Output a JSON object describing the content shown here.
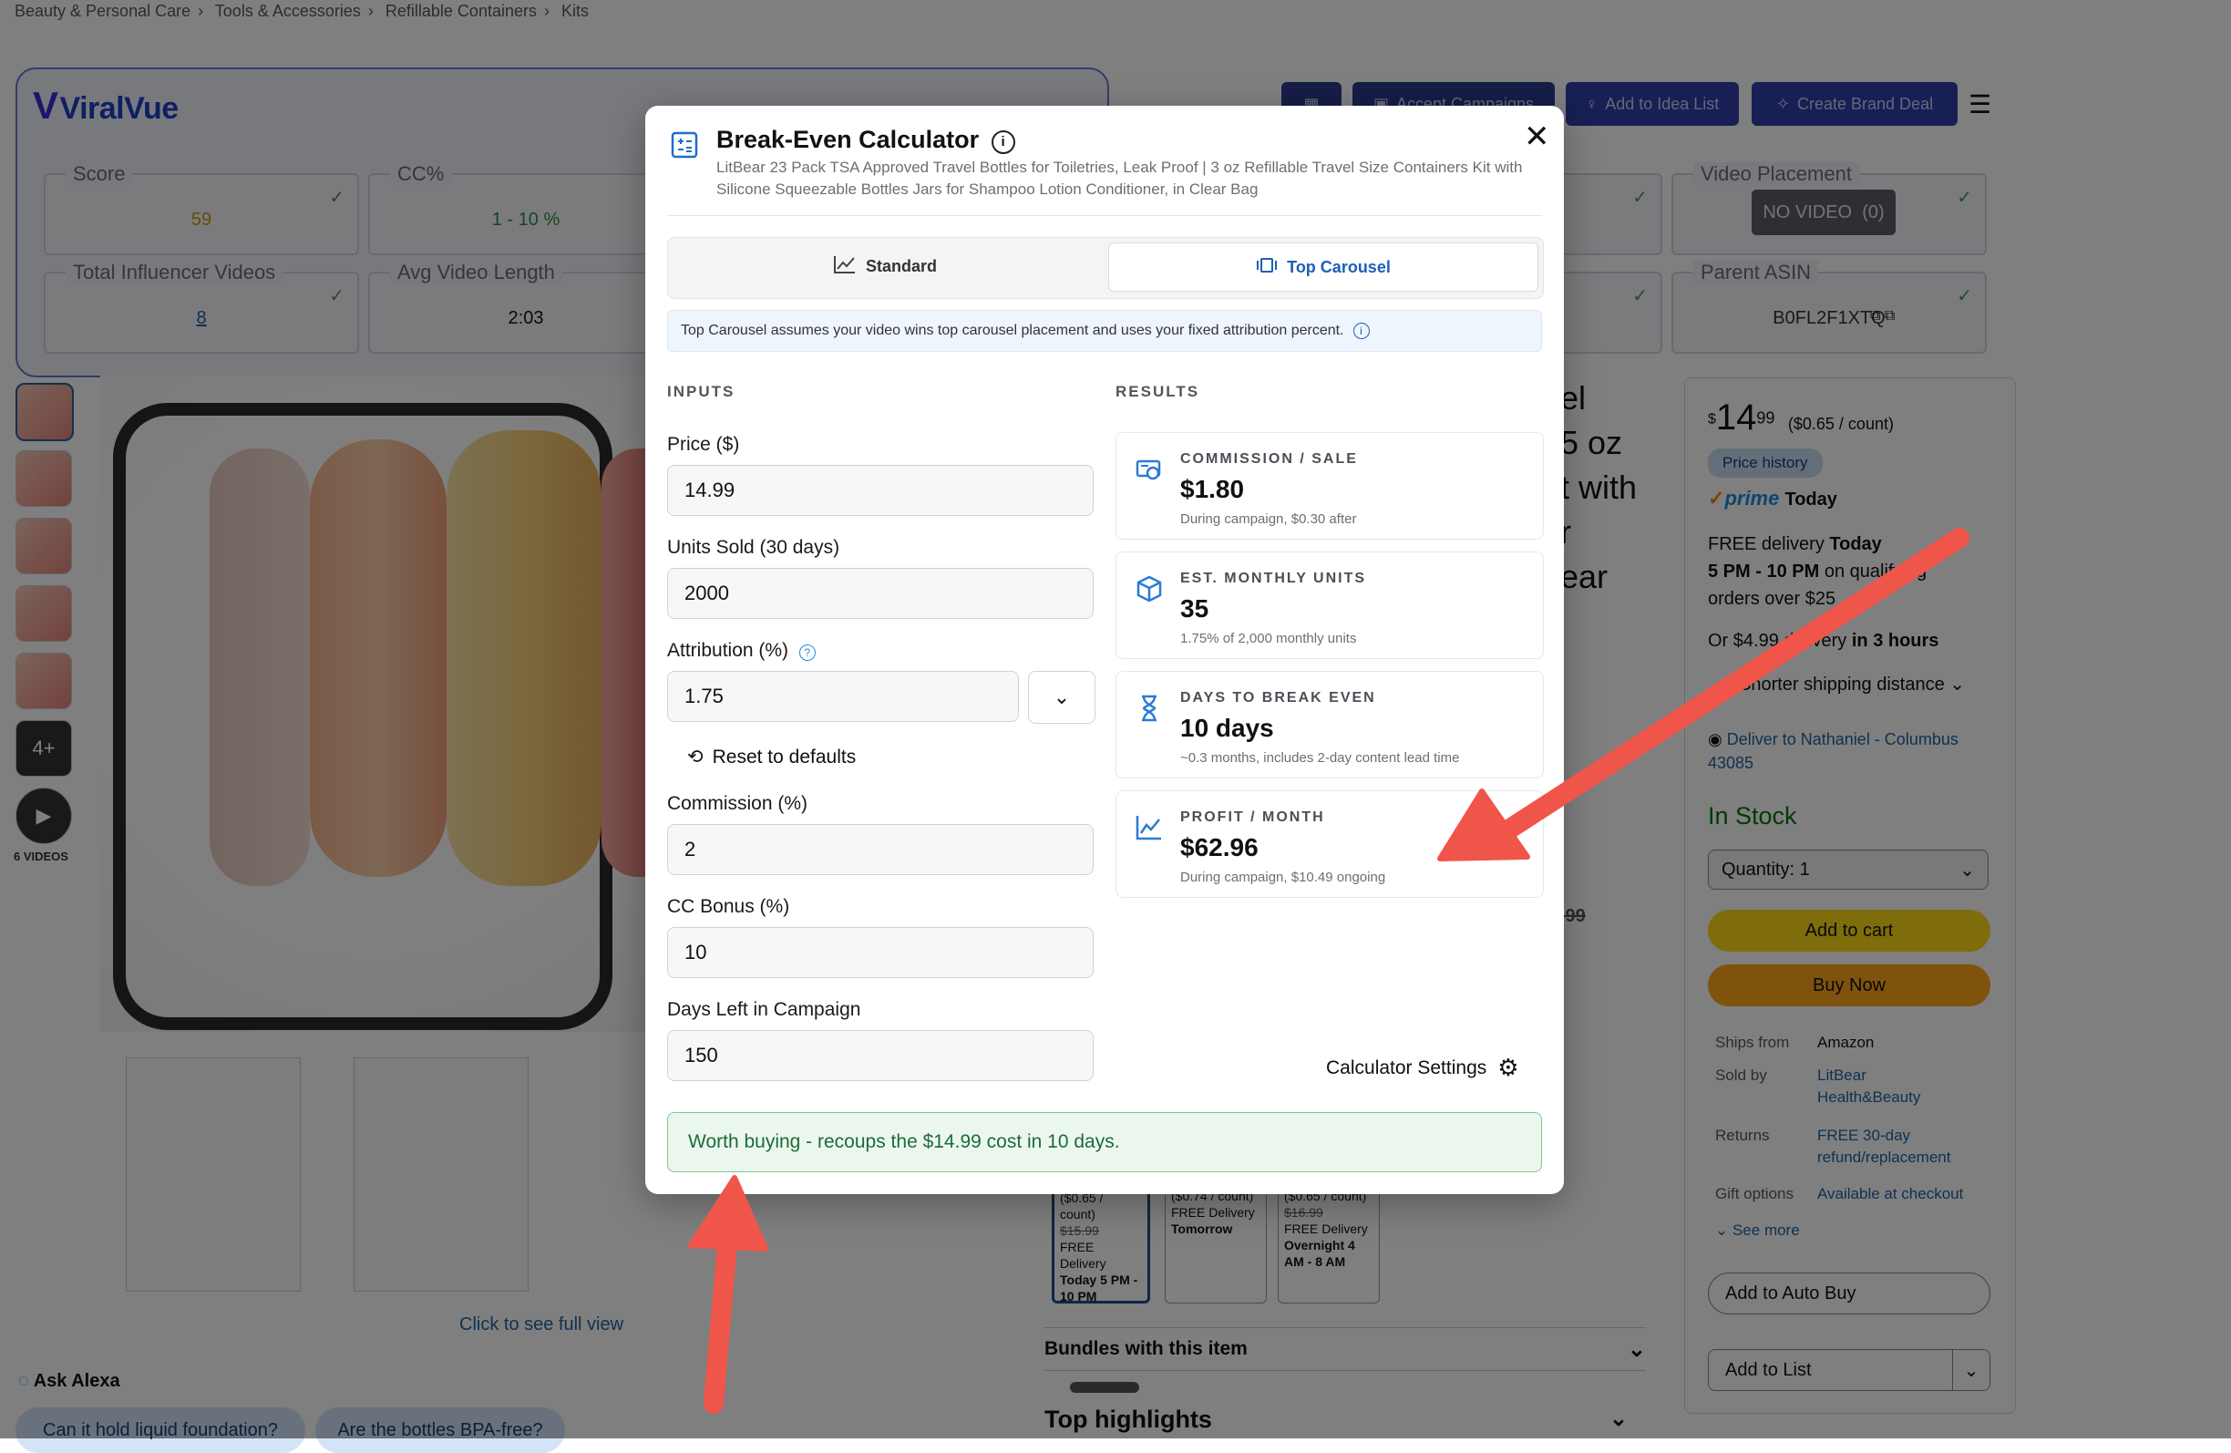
{
  "breadcrumb": [
    "Beauty & Personal Care",
    "Tools & Accessories",
    "Refillable Containers",
    "Kits"
  ],
  "viralvue": {
    "logo": "ViralVue",
    "toolbar": {
      "campaigns_label": "Accept Campaigns",
      "idea_label": "Add to Idea List",
      "brand_deal_label": "Create Brand Deal"
    },
    "metrics": {
      "score_label": "Score",
      "score_value": "59",
      "cc_label": "CC%",
      "cc_value": "1 - 10 %",
      "videos_label": "Total Influencer Videos",
      "videos_value": "8",
      "avglen_label": "Avg Video Length",
      "avglen_value": "2:03",
      "placement_label": "Video Placement",
      "placement_value": "NO VIDEO  (0)",
      "parent_label": "Parent ASIN",
      "parent_value": "B0FL2F1XTQ"
    }
  },
  "gallery": {
    "more_label": "4+",
    "videos_label": "6 VIDEOS",
    "full_view": "Click to see full view"
  },
  "alexa": {
    "title": "Ask Alexa",
    "q1": "Can it hold liquid foundation?",
    "q2": "Are the bottles BPA-free?"
  },
  "product_partial": {
    "title_lines": [
      "el",
      "5 oz",
      "t with",
      "r",
      "ear"
    ],
    "price_fragment": ".99",
    "bundles": "Bundles with this item",
    "highlights": "Top highlights",
    "options": [
      {
        "unit": "($0.65 / count)",
        "was": "$15.99",
        "delivery": "FREE Delivery",
        "when": "Today 5 PM - 10 PM"
      },
      {
        "unit": "($0.74 / count)",
        "was": "",
        "delivery": "FREE Delivery",
        "when": "Tomorrow"
      },
      {
        "unit": "($0.65 / count)",
        "was": "$16.99",
        "delivery": "FREE Delivery",
        "when": "Overnight 4 AM - 8 AM"
      }
    ]
  },
  "buybox": {
    "price_dollar": "$",
    "price_whole": "14",
    "price_cents": "99",
    "unit": "($0.65 / count)",
    "price_history": "Price history",
    "prime": "prime",
    "prime_today": "Today",
    "delivery_1": "FREE delivery",
    "delivery_1b": "Today",
    "delivery_2": "5 PM - 10 PM",
    "delivery_2b": "on qualifying",
    "delivery_3": "orders over $25",
    "delivery_4": "Or $4.99 delivery",
    "delivery_4b": "in 3 hours",
    "shorter": "Shorter shipping distance",
    "deliver_to": "Deliver to Nathaniel - Columbus 43085",
    "in_stock": "In Stock",
    "quantity": "Quantity:  1",
    "add_to_cart": "Add to cart",
    "buy_now": "Buy Now",
    "ships_from_label": "Ships from",
    "ships_from": "Amazon",
    "sold_by_label": "Sold by",
    "sold_by": "LitBear Health&Beauty",
    "returns_label": "Returns",
    "returns": "FREE 30-day refund/replacement",
    "gift_label": "Gift options",
    "gift": "Available at checkout",
    "see_more": "See more",
    "auto_buy": "Add to Auto Buy",
    "add_to_list": "Add to List"
  },
  "modal": {
    "title": "Break-Even Calculator",
    "subtitle": "LitBear 23 Pack TSA Approved Travel Bottles for Toiletries, Leak Proof | 3 oz Refillable Travel Size Containers Kit with Silicone Squeezable Bottles Jars for Shampoo Lotion Conditioner, in Clear Bag",
    "tab_standard": "Standard",
    "tab_carousel": "Top Carousel",
    "note": "Top Carousel assumes your video wins top carousel placement and uses your fixed attribution percent.",
    "inputs_heading": "INPUTS",
    "results_heading": "RESULTS",
    "price_label": "Price ($)",
    "price_value": "14.99",
    "units_label": "Units Sold (30 days)",
    "units_value": "2000",
    "attr_label": "Attribution (%)",
    "attr_value": "1.75",
    "reset_label": "Reset to defaults",
    "commission_label": "Commission (%)",
    "commission_value": "2",
    "cc_label": "CC Bonus (%)",
    "cc_value": "10",
    "days_label": "Days Left in Campaign",
    "days_value": "150",
    "settings_label": "Calculator Settings",
    "results": [
      {
        "title": "COMMISSION / SALE",
        "value": "$1.80",
        "sub": "During campaign, $0.30 after",
        "icon": "commission-icon"
      },
      {
        "title": "EST. MONTHLY UNITS",
        "value": "35",
        "sub": "1.75% of 2,000 monthly units",
        "icon": "box-icon"
      },
      {
        "title": "DAYS TO BREAK EVEN",
        "value": "10 days",
        "sub": "~0.3 months, includes 2-day content lead time",
        "icon": "hourglass-icon"
      },
      {
        "title": "PROFIT / MONTH",
        "value": "$62.96",
        "sub": "During campaign, $10.49 ongoing",
        "icon": "trend-chart-icon"
      }
    ],
    "verdict": "Worth buying - recoups the $14.99 cost in 10 days."
  },
  "colors": {
    "accent": "#1f3fc9",
    "arrow": "#f0554a",
    "success": "#1e6b36",
    "amazon_yellow": "#ffd814",
    "amazon_orange": "#ffa41c"
  }
}
